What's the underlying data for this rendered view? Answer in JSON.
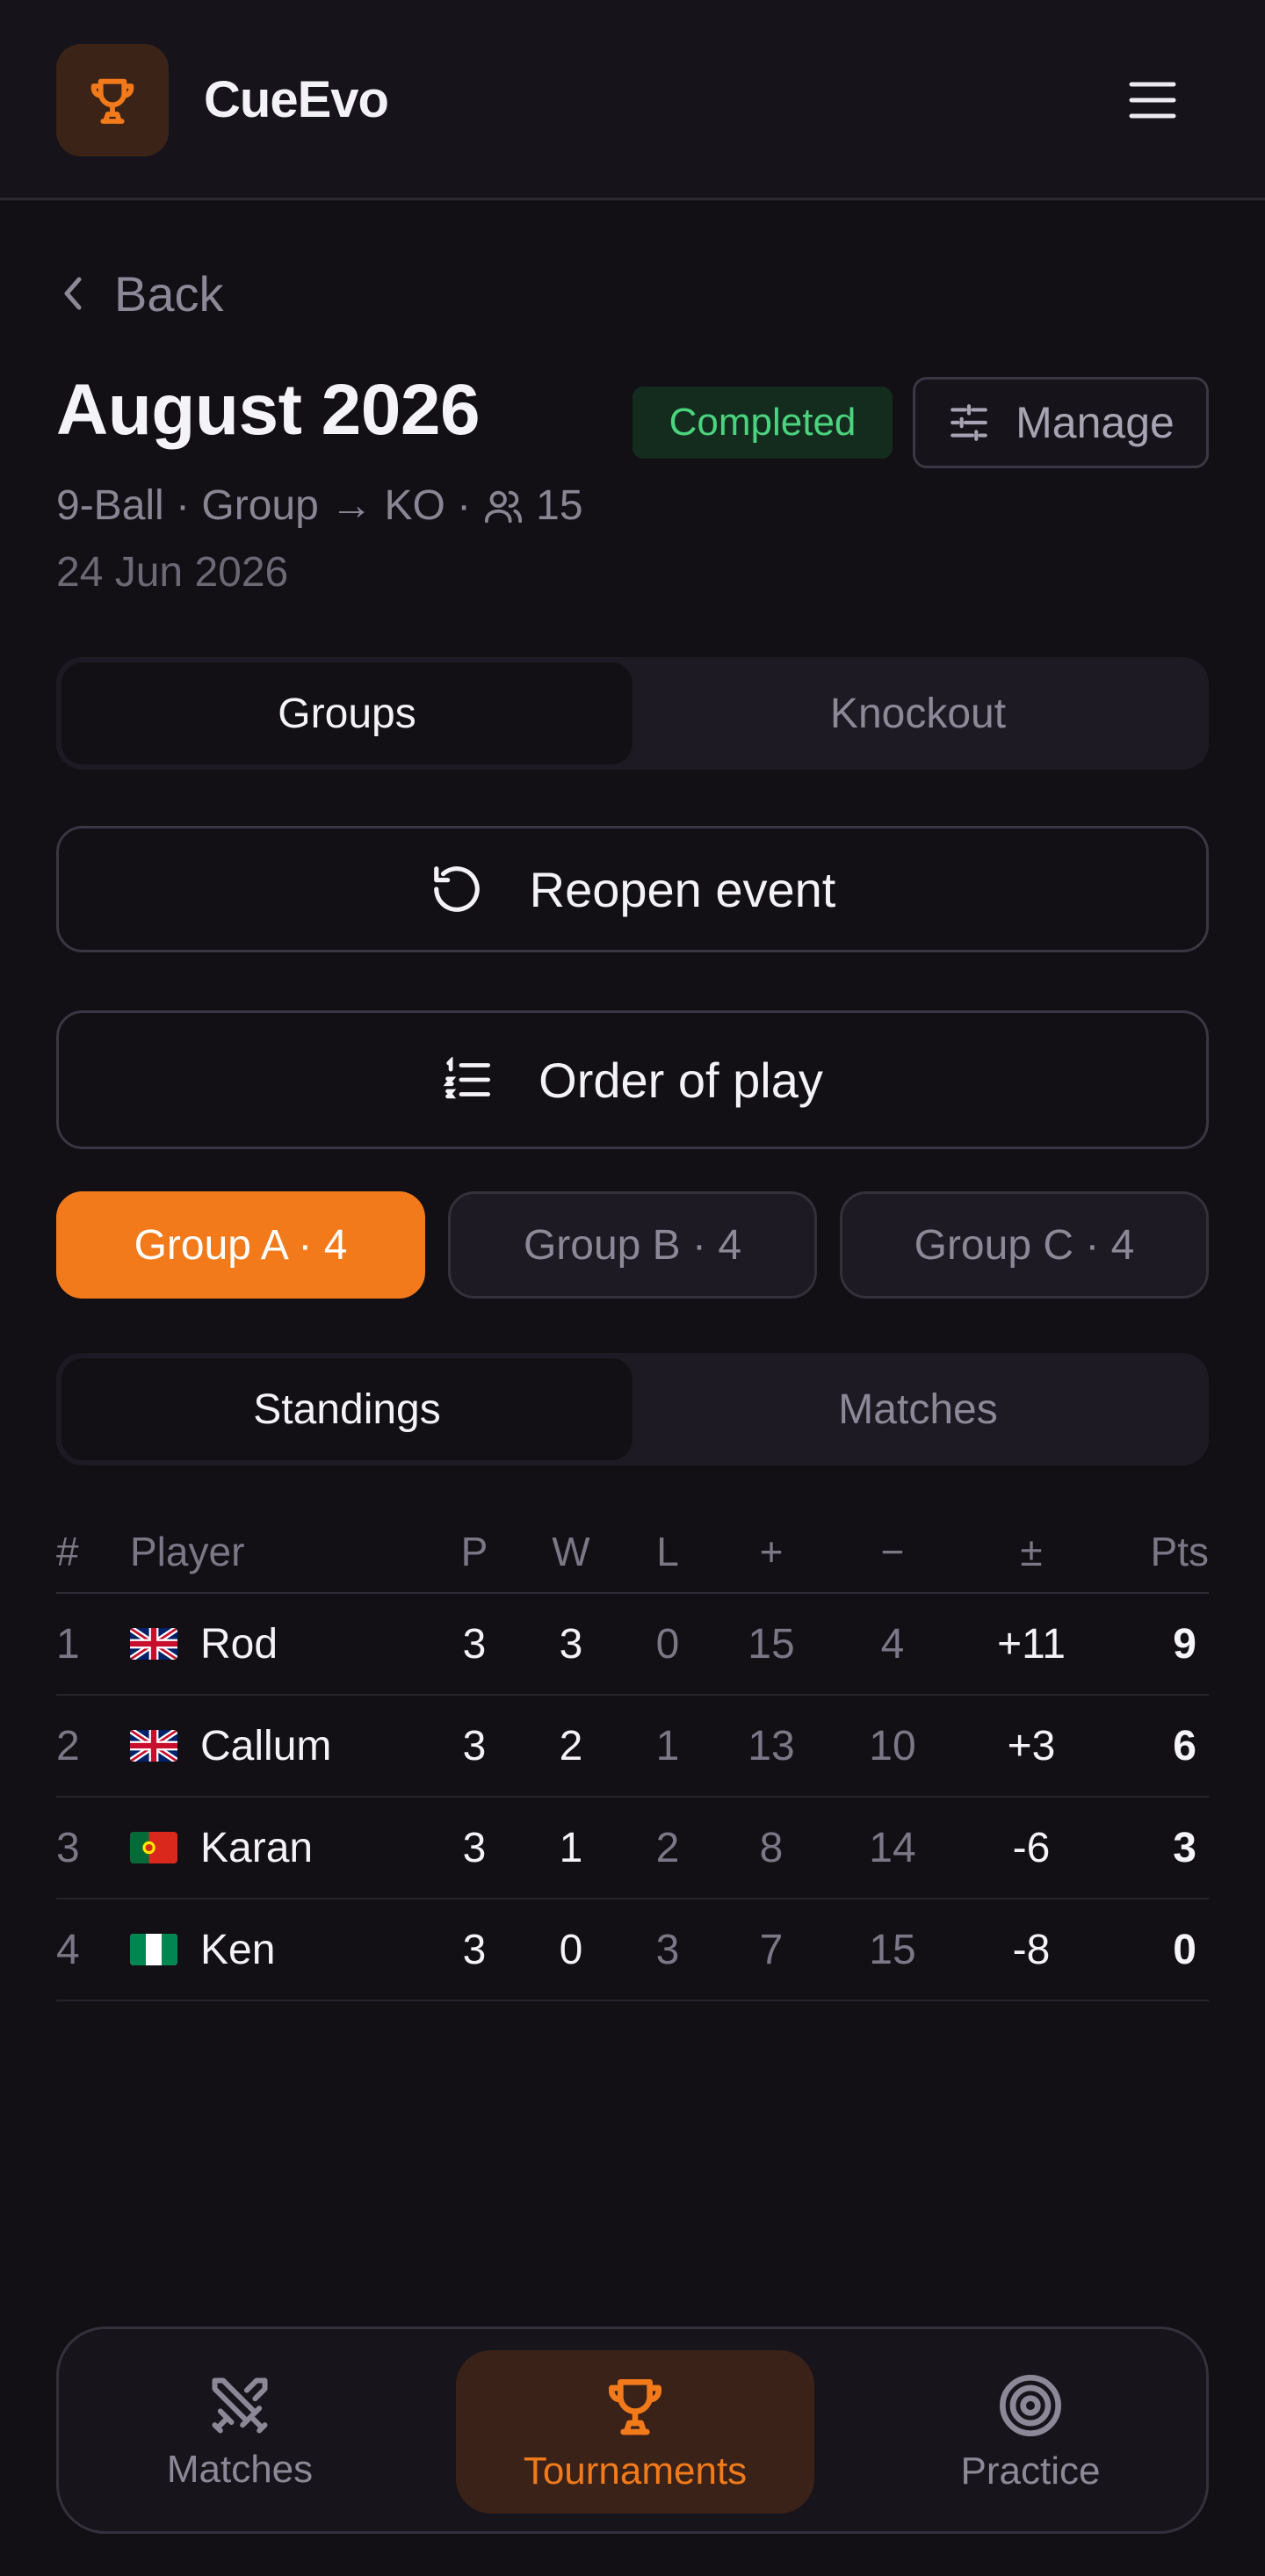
{
  "app": {
    "name": "CueEvo"
  },
  "nav": {
    "back_label": "Back"
  },
  "event": {
    "title": "August 2026",
    "status": "Completed",
    "manage_label": "Manage",
    "format": "9-Ball · Group → KO ·",
    "players_count": "15",
    "date": "24 Jun 2026"
  },
  "view_tabs": [
    {
      "label": "Groups",
      "active": true
    },
    {
      "label": "Knockout",
      "active": false
    }
  ],
  "actions": {
    "reopen_label": "Reopen event",
    "order_of_play_label": "Order of play"
  },
  "groups": [
    {
      "label": "Group A · 4",
      "active": true
    },
    {
      "label": "Group B · 4",
      "active": false
    },
    {
      "label": "Group C · 4",
      "active": false
    }
  ],
  "sub_tabs": [
    {
      "label": "Standings",
      "active": true
    },
    {
      "label": "Matches",
      "active": false
    }
  ],
  "standings": {
    "columns": [
      "#",
      "Player",
      "P",
      "W",
      "L",
      "+",
      "−",
      "±",
      "Pts"
    ],
    "rows": [
      {
        "rank": "1",
        "flag": "gb-flag-icon",
        "player": "Rod",
        "p": "3",
        "w": "3",
        "l": "0",
        "plus": "15",
        "minus": "4",
        "diff": "+11",
        "pts": "9"
      },
      {
        "rank": "2",
        "flag": "gb-flag-icon",
        "player": "Callum",
        "p": "3",
        "w": "2",
        "l": "1",
        "plus": "13",
        "minus": "10",
        "diff": "+3",
        "pts": "6"
      },
      {
        "rank": "3",
        "flag": "pt-flag-icon",
        "player": "Karan",
        "p": "3",
        "w": "1",
        "l": "2",
        "plus": "8",
        "minus": "14",
        "diff": "-6",
        "pts": "3"
      },
      {
        "rank": "4",
        "flag": "ng-flag-icon",
        "player": "Ken",
        "p": "3",
        "w": "0",
        "l": "3",
        "plus": "7",
        "minus": "15",
        "diff": "-8",
        "pts": "0"
      }
    ]
  },
  "bottom_nav": [
    {
      "label": "Matches",
      "icon": "crossed-cues-icon",
      "active": false
    },
    {
      "label": "Tournaments",
      "icon": "trophy-icon",
      "active": true
    },
    {
      "label": "Practice",
      "icon": "target-icon",
      "active": false
    }
  ],
  "colors": {
    "accent": "#f27a1a",
    "background": "#120f15",
    "success": "#4bd47f"
  }
}
